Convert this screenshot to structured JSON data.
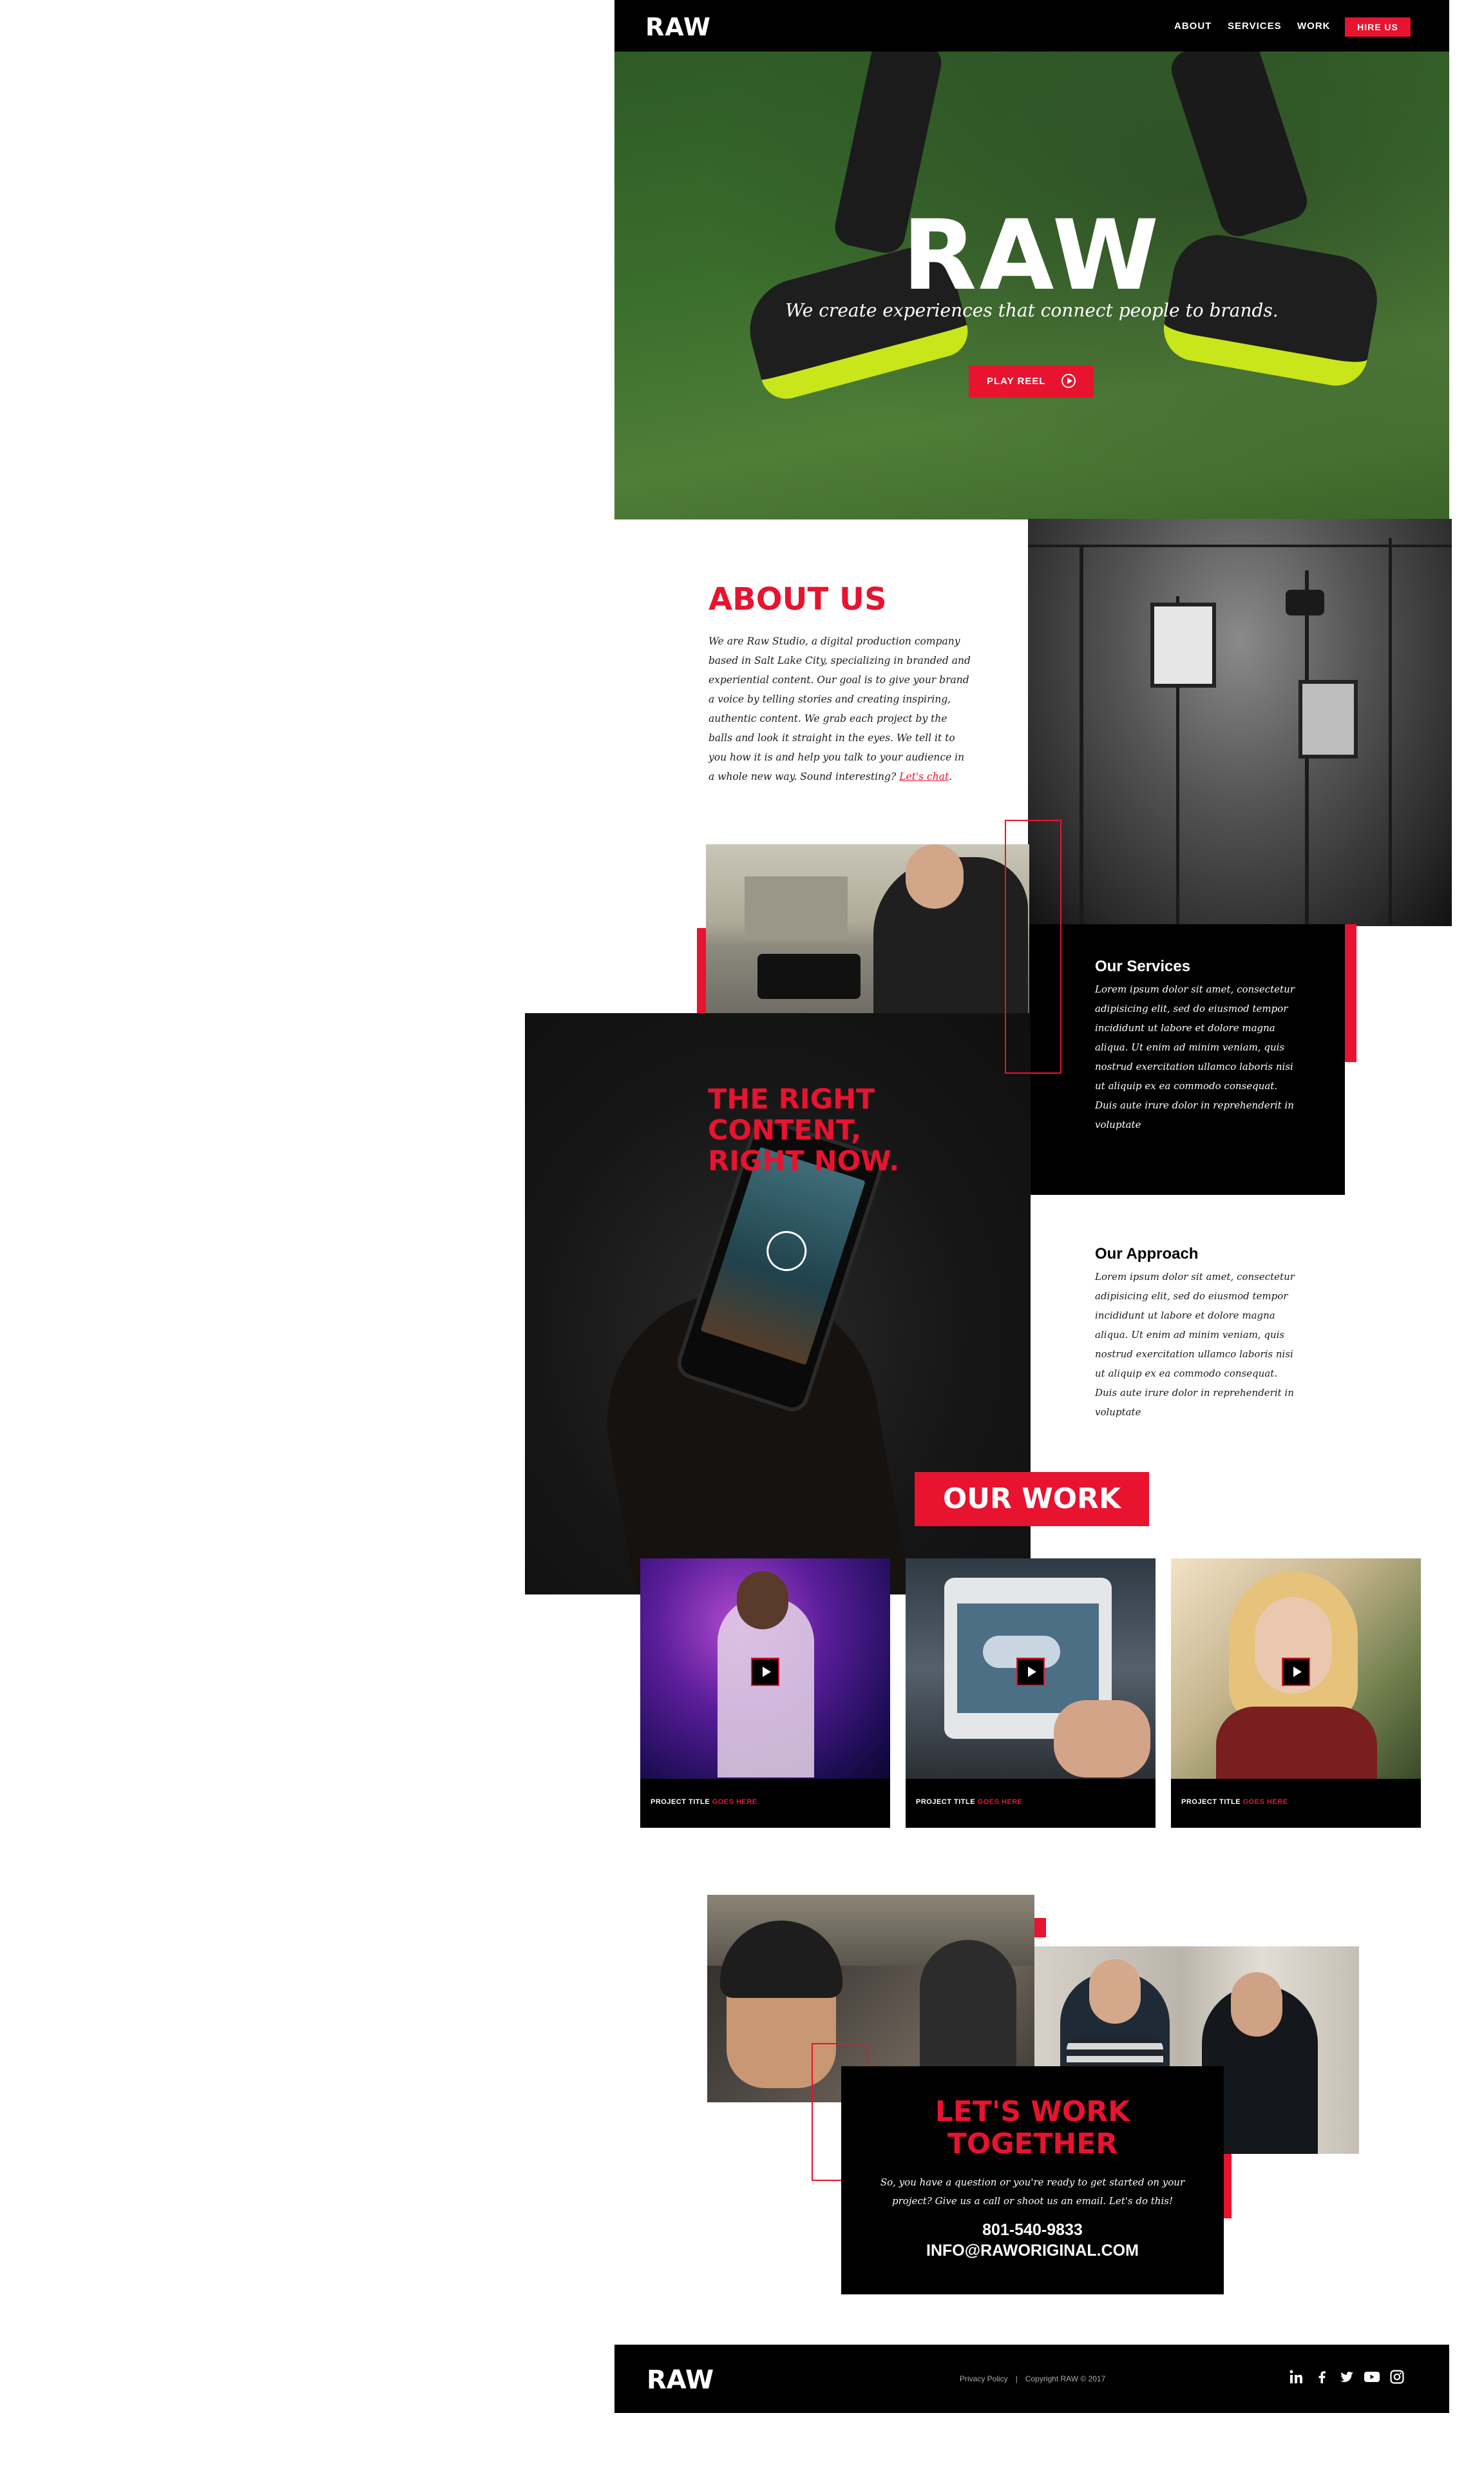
{
  "nav": {
    "logo": "RAW",
    "items": [
      "ABOUT",
      "SERVICES",
      "WORK"
    ],
    "cta": "HIRE US"
  },
  "hero": {
    "title": "RAW",
    "tagline": "We create experiences that connect people to brands.",
    "button": "PLAY REEL"
  },
  "about": {
    "title": "ABOUT US",
    "text": "We are Raw Studio, a digital production company based in Salt Lake City, specializing in branded and experiential content. Our goal is to give your brand a voice by telling stories and creating inspiring, authentic content. We grab each project by the balls and look it straight in the eyes. We tell it to you how it is and help you talk to your audience in a whole new way. Sound interesting? ",
    "link": "Let's chat",
    "link_end": "."
  },
  "services": {
    "title": "Our Services",
    "text": "Lorem ipsum dolor sit amet, consectetur adipisicing elit, sed do eiusmod tempor incididunt ut labore et dolore magna aliqua. Ut enim ad minim veniam, quis nostrud exercitation ullamco laboris nisi ut aliquip ex ea commodo consequat. Duis aute irure dolor in reprehenderit in voluptate"
  },
  "content": {
    "headline_1": "THE RIGHT",
    "headline_2": "CONTENT,",
    "headline_3": "RIGHT NOW."
  },
  "approach": {
    "title": "Our Approach",
    "text": "Lorem ipsum dolor sit amet, consectetur adipisicing elit, sed do eiusmod tempor incididunt ut labore et dolore magna aliqua. Ut enim ad minim veniam, quis nostrud exercitation ullamco laboris nisi ut aliquip ex ea commodo consequat. Duis aute irure dolor in reprehenderit in voluptate"
  },
  "work": {
    "title": "OUR WORK",
    "projects": [
      {
        "label": "PROJECT TITLE",
        "accent": "GOES HERE"
      },
      {
        "label": "PROJECT TITLE",
        "accent": "GOES HERE"
      },
      {
        "label": "PROJECT TITLE",
        "accent": "GOES HERE"
      }
    ]
  },
  "contact": {
    "title_1": "LET'S WORK",
    "title_2": "TOGETHER",
    "text": "So, you have a question or you're ready to get started on your project? Give us a call or shoot us an email. Let's do this!",
    "phone": "801-540-9833",
    "email": "INFO@RAWORIGINAL.COM"
  },
  "footer": {
    "logo": "RAW",
    "privacy": "Privacy Policy",
    "separator": "|",
    "copyright": "Copyright RAW  © 2017",
    "social": [
      "linkedin-icon",
      "facebook-icon",
      "twitter-icon",
      "youtube-icon",
      "instagram-icon"
    ]
  },
  "colors": {
    "accent": "#e8132f",
    "dark": "#000000",
    "light": "#ffffff"
  }
}
